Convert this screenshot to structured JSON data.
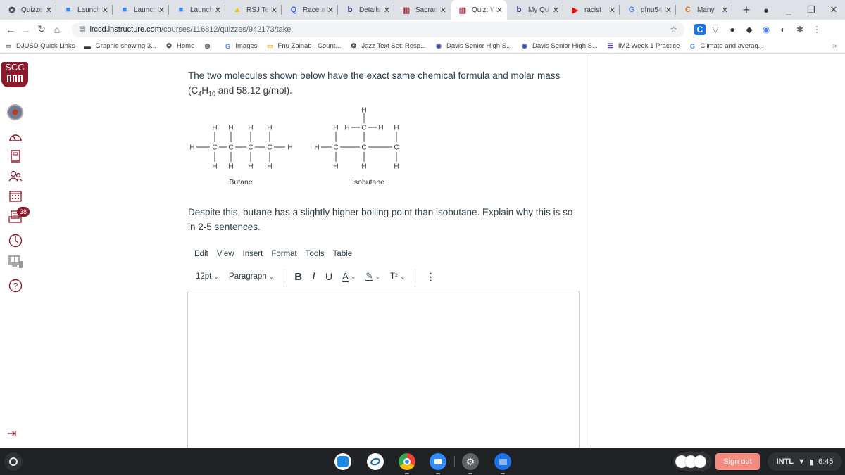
{
  "browser": {
    "tabs": [
      {
        "label": "Quizzes",
        "icon": "canvas-icon",
        "active": false
      },
      {
        "label": "Launch",
        "icon": "zoom-icon",
        "active": false
      },
      {
        "label": "Launch",
        "icon": "zoom-icon",
        "active": false
      },
      {
        "label": "Launch",
        "icon": "zoom-icon",
        "active": false
      },
      {
        "label": "RSJ Te",
        "icon": "google-drive-icon",
        "active": false
      },
      {
        "label": "Race a",
        "icon": "quizlet-icon",
        "active": false
      },
      {
        "label": "Details",
        "icon": "bartleby-icon",
        "active": false
      },
      {
        "label": "Sacram",
        "icon": "college-icon",
        "active": false
      },
      {
        "label": "Quiz: W",
        "icon": "college-icon",
        "active": true
      },
      {
        "label": "My Qu",
        "icon": "bartleby-icon",
        "active": false
      },
      {
        "label": "racist",
        "icon": "youtube-icon",
        "active": false
      },
      {
        "label": "gfnu54",
        "icon": "google-icon",
        "active": false
      },
      {
        "label": "Many",
        "icon": "chegg-icon",
        "active": false
      }
    ],
    "new_tab_label": "+",
    "url_host": "lrccd.instructure.com",
    "url_path": "/courses/116812/quizzes/942173/take",
    "bookmarks": [
      {
        "label": "DJUSD Quick Links",
        "icon": "folder-icon"
      },
      {
        "label": "Graphic showing 3...",
        "icon": "graphic-icon"
      },
      {
        "label": "Home",
        "icon": "canvas-icon"
      },
      {
        "label": "",
        "icon": "globe-icon"
      },
      {
        "label": "Images",
        "icon": "google-icon"
      },
      {
        "label": "Fnu Zainab - Count...",
        "icon": "slides-icon"
      },
      {
        "label": "Jazz Text Set: Resp...",
        "icon": "canvas-icon"
      },
      {
        "label": "Davis Senior High S...",
        "icon": "school-icon"
      },
      {
        "label": "Davis Senior High S...",
        "icon": "school-icon"
      },
      {
        "label": "IM2 Week 1 Practice",
        "icon": "forms-icon"
      },
      {
        "label": "Climate and averag...",
        "icon": "google-icon"
      }
    ],
    "bookmarks_more": "»"
  },
  "sidebar": {
    "logo_text": "SCC",
    "items": [
      {
        "name": "account",
        "icon": "avatar"
      },
      {
        "name": "dashboard",
        "icon": "dashboard-icon"
      },
      {
        "name": "courses",
        "icon": "courses-icon"
      },
      {
        "name": "groups",
        "icon": "groups-icon"
      },
      {
        "name": "calendar",
        "icon": "calendar-icon"
      },
      {
        "name": "inbox",
        "icon": "inbox-icon",
        "badge": "38"
      },
      {
        "name": "history",
        "icon": "clock-icon"
      },
      {
        "name": "commons",
        "icon": "commons-icon"
      },
      {
        "name": "help",
        "icon": "help-icon"
      }
    ],
    "collapse_icon": "collapse-icon"
  },
  "question": {
    "intro_part1": "The two molecules shown below have the exact same chemical formula and molar mass (C",
    "sub1": "4",
    "intro_part2": "H",
    "sub2": "10",
    "intro_part3": " and 58.12 g/mol).",
    "diagram": {
      "butane_label": "Butane",
      "isobutane_label": "Isobutane",
      "atom_h": "H",
      "atom_c": "C"
    },
    "prompt": "Despite this, butane has a slightly higher boiling point than isobutane. Explain why this is so in 2-5 sentences."
  },
  "editor": {
    "menu": [
      "Edit",
      "View",
      "Insert",
      "Format",
      "Tools",
      "Table"
    ],
    "font_size": "12pt",
    "block_format": "Paragraph",
    "bold": "B",
    "italic": "I",
    "underline": "U",
    "font_color": "A",
    "highlight": "✎",
    "superscript": "T²",
    "more": "⋮",
    "chevron": "⌄",
    "content": ""
  },
  "shelf": {
    "sign_out_label": "Sign out",
    "input_method": "INTL",
    "time": "6:45"
  },
  "colors": {
    "brand": "#8b1a2b",
    "sign_out": "#f28b82"
  }
}
